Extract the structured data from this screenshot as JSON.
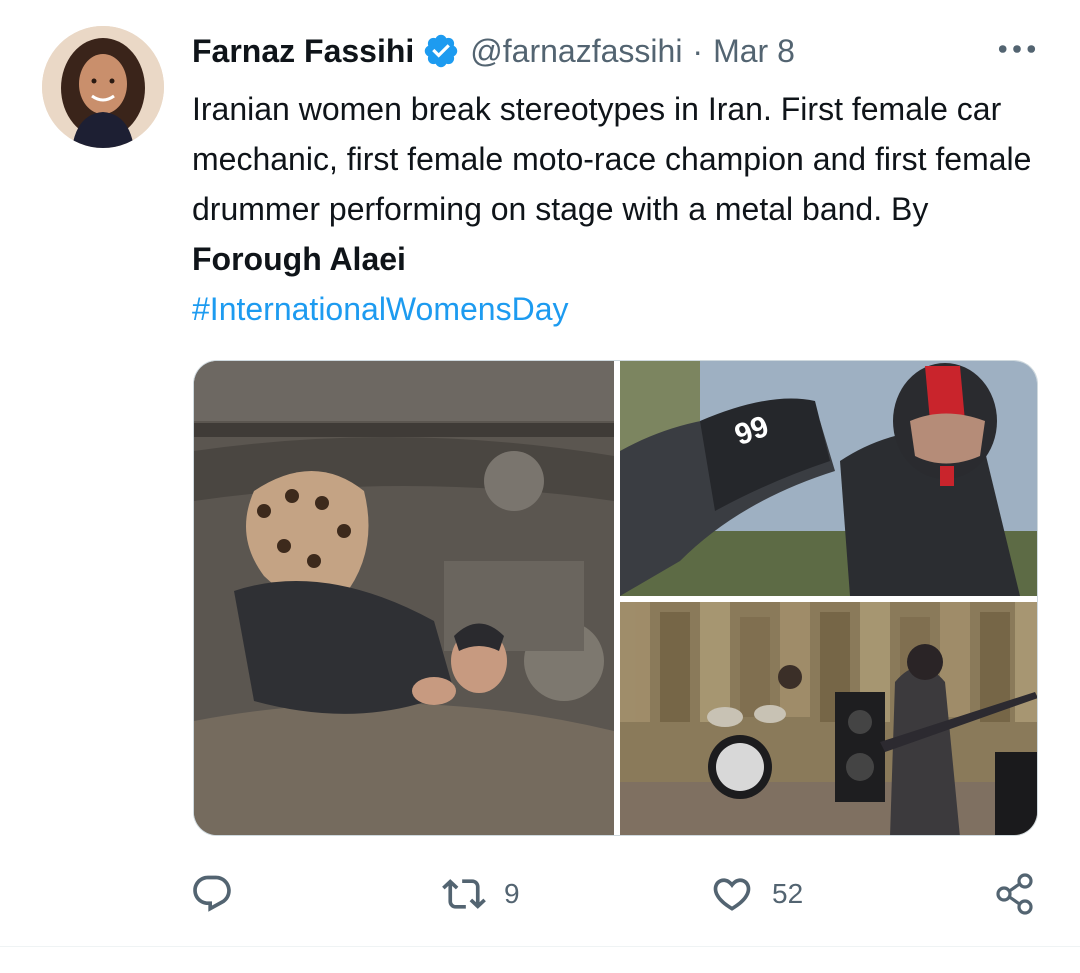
{
  "tweet": {
    "author": {
      "name": "Farnaz Fassihi",
      "handle": "@farnazfassihi",
      "verified_icon": "verified-badge-icon"
    },
    "separator": "·",
    "date": "Mar 8",
    "more_icon": "more-options-icon",
    "text": {
      "part1": "Iranian women break stereotypes in Iran. First female car mechanic, first female moto-race champion and first female drummer performing on stage with a metal band. By ",
      "photographer": "Forough Alaei",
      "hashtag": "#InternationalWomensDay"
    },
    "media": {
      "count": 3
    },
    "actions": {
      "reply_icon": "reply-icon",
      "retweet_icon": "retweet-icon",
      "retweet_count": "9",
      "like_icon": "heart-icon",
      "like_count": "52",
      "share_icon": "share-icon"
    }
  },
  "colors": {
    "text": "#0f1419",
    "secondary": "#536471",
    "accent": "#1d9bf0"
  }
}
